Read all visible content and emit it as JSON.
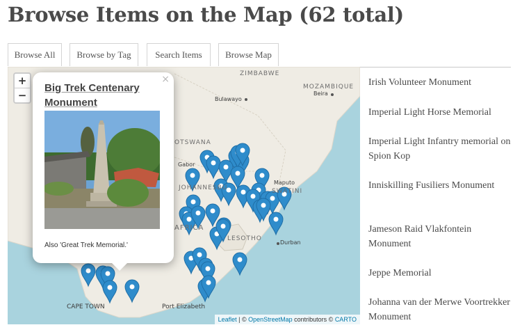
{
  "page": {
    "title": "Browse Items on the Map (62 total)"
  },
  "tabs": [
    {
      "label": "Browse All"
    },
    {
      "label": "Browse by Tag"
    },
    {
      "label": "Search Items"
    },
    {
      "label": "Browse Map"
    }
  ],
  "map": {
    "zoom_in": "+",
    "zoom_out": "−",
    "labels": {
      "zimbabwe": "ZIMBABWE",
      "mozambique": "MOZAMBIQUE",
      "beira": "Beira",
      "bulawayo": "Bulawayo",
      "botswana": "OTSWANA",
      "gaborone": "Gabor",
      "johannesburg": "JOHANNESBU",
      "maputo": "Maputo",
      "eswatini": "SWATINI",
      "south_africa": "AFRICA",
      "lesotho": "LESOTHO",
      "durban": "Durban",
      "cape_town": "CAPE TOWN",
      "port_elizabeth": "Port Elizabeth"
    },
    "marker_color": "#2f8ccb",
    "popup": {
      "close": "×",
      "title": "Big Trek Centenary Monument",
      "caption": "Also 'Great Trek Memorial.'"
    },
    "attribution": {
      "leaflet": "Leaflet",
      "sep": " | © ",
      "osm": "OpenStreetMap",
      "contrib": " contributors © ",
      "carto": "CARTO"
    }
  },
  "items": [
    {
      "title": "Irish Volunteer Monument"
    },
    {
      "title": "Imperial Light Horse Memorial"
    },
    {
      "title": "Imperial Light Infantry memorial on Spion Kop"
    },
    {
      "title": "Inniskilling Fusiliers Monument"
    },
    {
      "title": "Jameson Raid Vlakfontein Monument"
    },
    {
      "title": "Jeppe Memorial"
    },
    {
      "title": "Johanna van der Merwe Voortrekker Monument"
    }
  ]
}
